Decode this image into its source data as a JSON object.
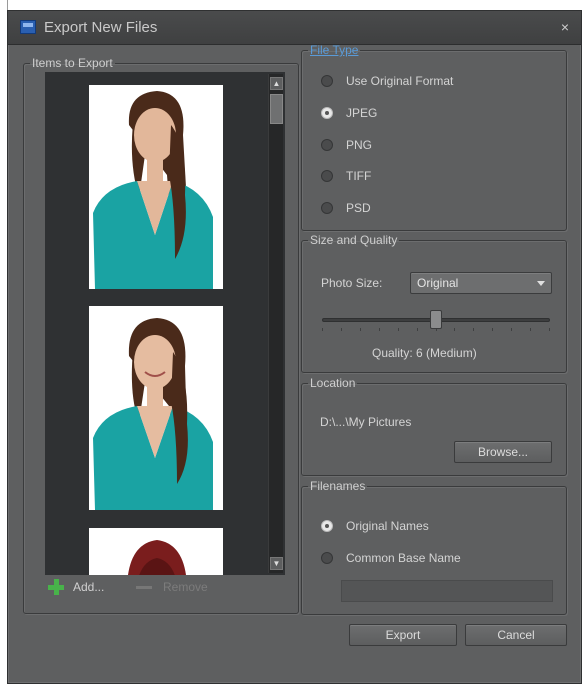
{
  "window": {
    "title": "Export New Files",
    "close_glyph": "×"
  },
  "items_panel": {
    "legend": "Items to Export",
    "add_label": "Add...",
    "remove_label": "Remove"
  },
  "file_type": {
    "legend": "File Type",
    "options": [
      {
        "label": "Use Original Format",
        "checked": false
      },
      {
        "label": "JPEG",
        "checked": true
      },
      {
        "label": "PNG",
        "checked": false
      },
      {
        "label": "TIFF",
        "checked": false
      },
      {
        "label": "PSD",
        "checked": false
      }
    ]
  },
  "size_quality": {
    "legend": "Size and Quality",
    "photo_size_label": "Photo Size:",
    "photo_size_value": "Original",
    "quality_label": "Quality: 6 (Medium)",
    "quality_level": 6,
    "quality_max": 12
  },
  "location": {
    "legend": "Location",
    "path": "D:\\...\\My Pictures",
    "browse_label": "Browse..."
  },
  "filenames": {
    "legend": "Filenames",
    "options": [
      {
        "label": "Original Names",
        "checked": true
      },
      {
        "label": "Common Base Name",
        "checked": false
      }
    ],
    "base_name_value": ""
  },
  "footer": {
    "export_label": "Export",
    "cancel_label": "Cancel"
  },
  "colors": {
    "dialog_bg": "#5e5f60",
    "thumb_list_bg": "#2f3133",
    "link_blue": "#5a9bd8",
    "shirt_teal": "#1aa3a3",
    "add_green": "#48b24a"
  },
  "icons": {
    "app": "app-icon",
    "add": "plus-icon",
    "remove": "minus-icon"
  }
}
